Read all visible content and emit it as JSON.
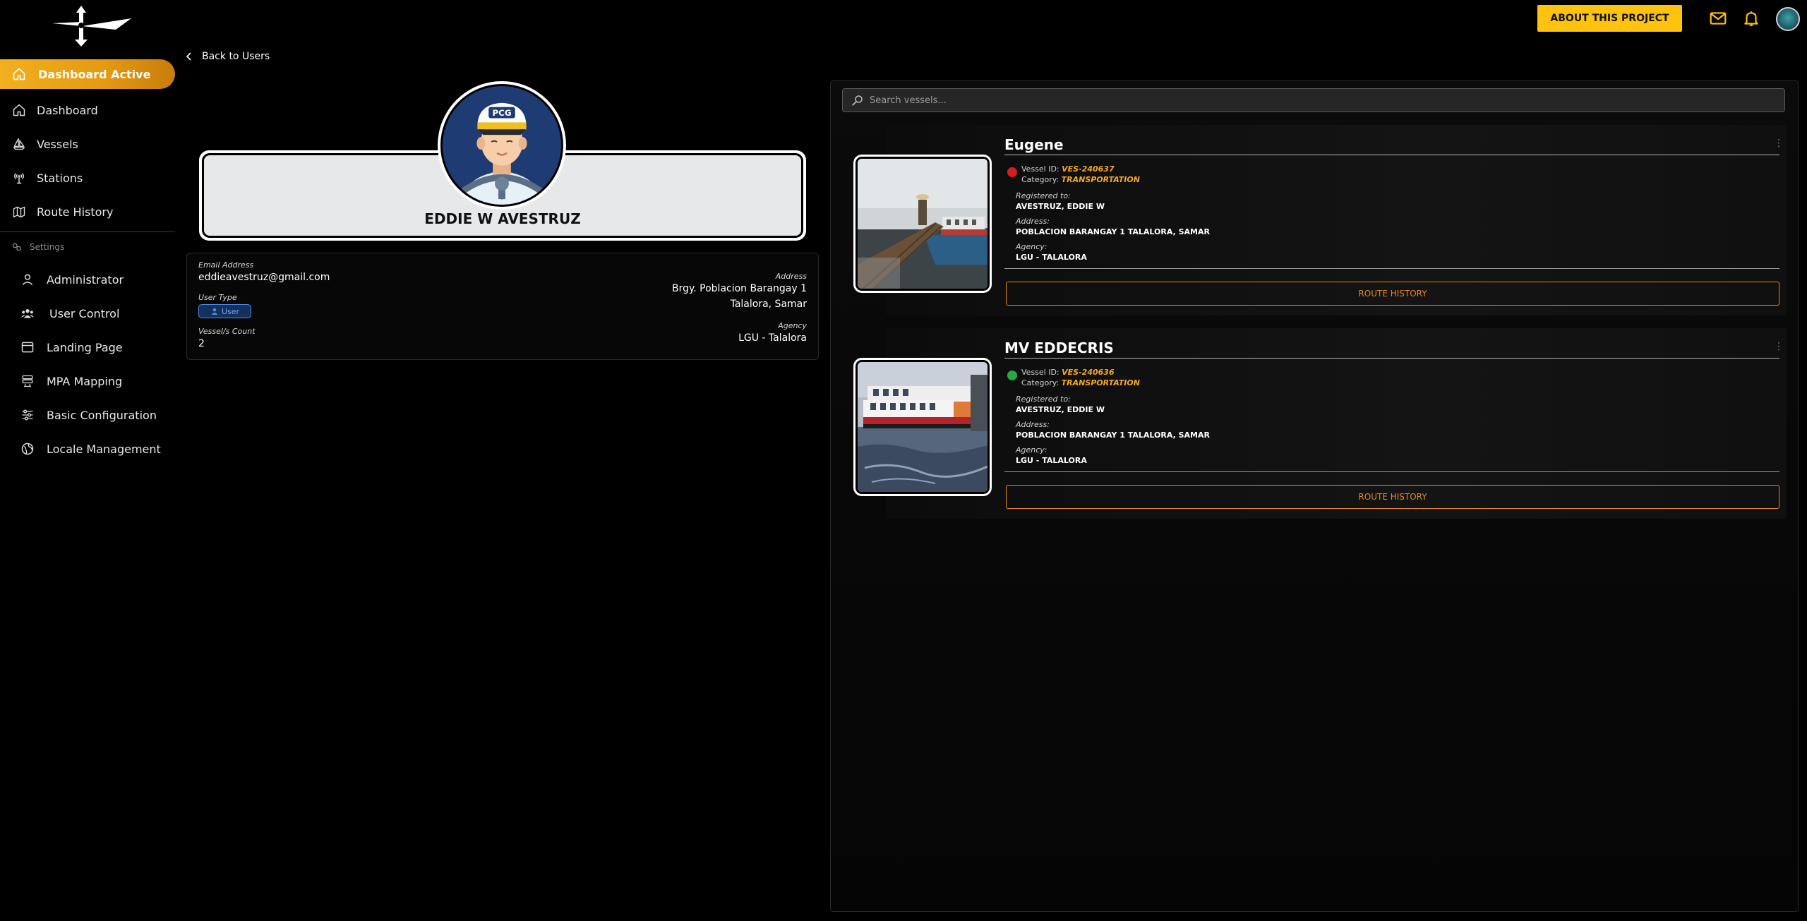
{
  "topbar": {
    "about_label": "ABOUT THIS PROJECT"
  },
  "sidebar": {
    "active_label": "Dashboard Active",
    "items": [
      {
        "label": "Dashboard",
        "icon": "home-icon"
      },
      {
        "label": "Vessels",
        "icon": "sailboat-icon"
      },
      {
        "label": "Stations",
        "icon": "antenna-icon"
      },
      {
        "label": "Route History",
        "icon": "map-icon"
      }
    ],
    "settings_label": "Settings",
    "settings_items": [
      {
        "label": "Administrator",
        "icon": "person-icon"
      },
      {
        "label": "User Control",
        "icon": "users-icon"
      },
      {
        "label": "Landing Page",
        "icon": "window-icon"
      },
      {
        "label": "MPA Mapping",
        "icon": "layers-icon"
      },
      {
        "label": "Basic Configuration",
        "icon": "sliders-icon"
      },
      {
        "label": "Locale Management",
        "icon": "globe-icon"
      }
    ]
  },
  "back_label": "Back to Users",
  "profile": {
    "avatar_badge": "PCG",
    "name": "EDDIE W AVESTRUZ",
    "email_label": "Email Address",
    "email": "eddieavestruz@gmail.com",
    "user_type_label": "User Type",
    "user_type": "User",
    "vessel_count_label": "Vessel/s Count",
    "vessel_count": "2",
    "address_label": "Address",
    "address_line1": "Brgy. Poblacion Barangay 1",
    "address_line2": "Talalora, Samar",
    "agency_label": "Agency",
    "agency": "LGU - Talalora"
  },
  "search": {
    "placeholder": "Search vessels..."
  },
  "vessel_labels": {
    "vessel_id": "Vessel ID:",
    "category": "Category:",
    "registered_to": "Registered to:",
    "address": "Address:",
    "agency": "Agency:",
    "route_history": "ROUTE HISTORY"
  },
  "vessels": [
    {
      "name": "Eugene",
      "status_color": "#d21f1f",
      "vessel_id": "VES-240637",
      "category": "TRANSPORTATION",
      "registered_to": "AVESTRUZ, EDDIE W",
      "address": "POBLACION BARANGAY 1 TALALORA, SAMAR",
      "agency": "LGU - TALALORA"
    },
    {
      "name": "MV EDDECRIS",
      "status_color": "#27a844",
      "vessel_id": "VES-240636",
      "category": "TRANSPORTATION",
      "registered_to": "AVESTRUZ, EDDIE W",
      "address": "POBLACION BARANGAY 1 TALALORA, SAMAR",
      "agency": "LGU - TALALORA"
    }
  ],
  "colors": {
    "accent": "#ffc20e",
    "route_button": "#e7861f",
    "highlight": "#f5a623"
  }
}
